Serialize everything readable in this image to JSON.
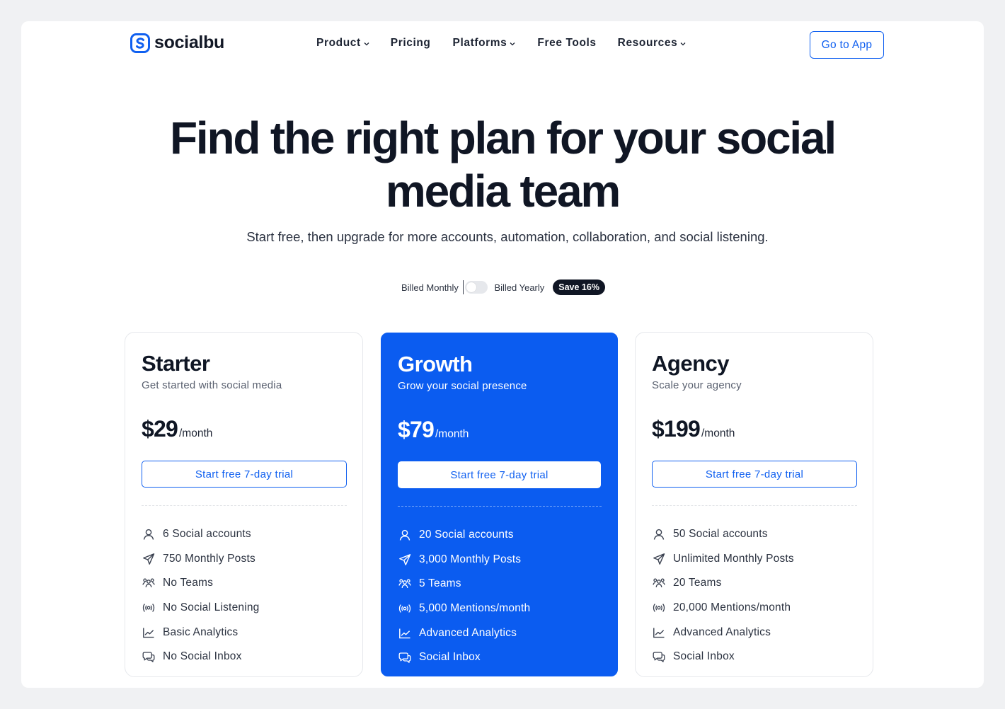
{
  "brand": {
    "name": "socialbu",
    "color": "#1060f0"
  },
  "nav": {
    "items": [
      {
        "label": "Product",
        "has_dropdown": true
      },
      {
        "label": "Pricing",
        "has_dropdown": false
      },
      {
        "label": "Platforms",
        "has_dropdown": true
      },
      {
        "label": "Free Tools",
        "has_dropdown": false
      },
      {
        "label": "Resources",
        "has_dropdown": true
      }
    ],
    "cta": "Go to App"
  },
  "hero": {
    "title": "Find the right plan for your social media team",
    "subtitle": "Start free, then upgrade for more accounts, automation, collaboration, and social listening."
  },
  "billing": {
    "monthly_label": "Billed Monthly",
    "yearly_label": "Billed Yearly",
    "save_badge": "Save 16%",
    "yearly_selected": false
  },
  "plans": [
    {
      "name": "Starter",
      "tagline": "Get started with social media",
      "price": "$29",
      "period": "/month",
      "cta": "Start free 7-day trial",
      "highlighted": false,
      "features": [
        {
          "icon": "user-icon",
          "text": "6 Social accounts"
        },
        {
          "icon": "send-icon",
          "text": "750 Monthly Posts"
        },
        {
          "icon": "team-icon",
          "text": "No Teams"
        },
        {
          "icon": "broadcast-icon",
          "text": "No Social Listening"
        },
        {
          "icon": "chart-icon",
          "text": "Basic Analytics"
        },
        {
          "icon": "chat-icon",
          "text": "No Social Inbox"
        }
      ]
    },
    {
      "name": "Growth",
      "tagline": "Grow your social presence",
      "price": "$79",
      "period": "/month",
      "cta": "Start free 7-day trial",
      "highlighted": true,
      "features": [
        {
          "icon": "user-icon",
          "text": "20 Social accounts"
        },
        {
          "icon": "send-icon",
          "text": "3,000 Monthly Posts"
        },
        {
          "icon": "team-icon",
          "text": "5 Teams"
        },
        {
          "icon": "broadcast-icon",
          "text": "5,000 Mentions/month"
        },
        {
          "icon": "chart-icon",
          "text": "Advanced Analytics"
        },
        {
          "icon": "chat-icon",
          "text": "Social Inbox"
        }
      ]
    },
    {
      "name": "Agency",
      "tagline": "Scale your agency",
      "price": "$199",
      "period": "/month",
      "cta": "Start free 7-day trial",
      "highlighted": false,
      "features": [
        {
          "icon": "user-icon",
          "text": "50 Social accounts"
        },
        {
          "icon": "send-icon",
          "text": "Unlimited Monthly Posts"
        },
        {
          "icon": "team-icon",
          "text": "20 Teams"
        },
        {
          "icon": "broadcast-icon",
          "text": "20,000 Mentions/month"
        },
        {
          "icon": "chart-icon",
          "text": "Advanced Analytics"
        },
        {
          "icon": "chat-icon",
          "text": "Social Inbox"
        }
      ]
    }
  ],
  "colors": {
    "accent": "#1060f0",
    "highlight_card": "#0b5cf0",
    "text_dark": "#0f1624",
    "badge_bg": "#101624"
  }
}
